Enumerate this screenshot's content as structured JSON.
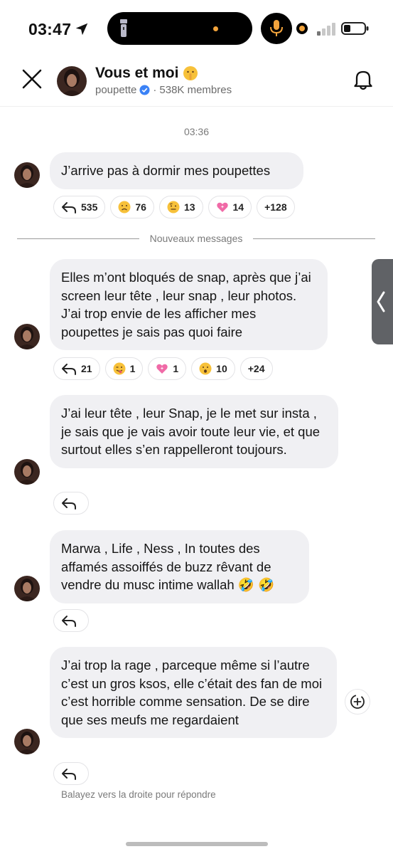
{
  "status_bar": {
    "time": "03:47"
  },
  "header": {
    "title": "Vous et moi",
    "title_emoji": "shushing-face",
    "creator": "poupette",
    "members": "538K membres",
    "separator": "·"
  },
  "timestamp": "03:36",
  "divider_label": "Nouveaux messages",
  "messages": [
    {
      "text": "J’arrive pas à dormir mes poupettes",
      "reactions": [
        {
          "icon": "reply-icon",
          "count": "535"
        },
        {
          "icon": "frowning-face",
          "count": "76"
        },
        {
          "icon": "raised-eyebrow-face",
          "count": "13"
        },
        {
          "icon": "sparkling-heart",
          "count": "14"
        },
        {
          "icon": "more",
          "count": "+128"
        }
      ]
    },
    {
      "text": "Elles m’ont bloqués de snap, après que j’ai screen leur tête , leur snap , leur photos. J’ai trop envie de les afficher mes poupettes je sais pas quoi faire",
      "reactions": [
        {
          "icon": "reply-icon",
          "count": "21"
        },
        {
          "icon": "winking-tongue-face",
          "count": "1"
        },
        {
          "icon": "sparkling-heart",
          "count": "1"
        },
        {
          "icon": "surprised-face",
          "count": "10"
        },
        {
          "icon": "more",
          "count": "+24"
        }
      ]
    },
    {
      "text": "J’ai leur tête , leur Snap, je le met sur insta , je sais que je vais avoir toute leur vie, et que surtout elles s’en rappelleront toujours.",
      "reactions": [
        {
          "icon": "reply-icon",
          "count": ""
        }
      ]
    },
    {
      "text": "Marwa , Life , Ness , In toutes des affamés assoiffés de buzz rêvant de vendre du musc intime wallah 🤣 🤣",
      "reactions": [
        {
          "icon": "reply-icon",
          "count": ""
        }
      ]
    },
    {
      "text": "J’ai trop la rage , parceque même si l’autre c’est un gros ksos, elle c’était des fan de moi c’est horrible comme sensation. De se dire que ses meufs me regardaient",
      "reactions": [
        {
          "icon": "reply-icon",
          "count": ""
        }
      ]
    }
  ],
  "hint": "Balayez vers la droite pour répondre",
  "colors": {
    "bubble": "#f0f0f3",
    "accent_orange": "#f3a43c",
    "verified_blue": "#3b82f6",
    "muted_text": "#7a7a7a"
  }
}
